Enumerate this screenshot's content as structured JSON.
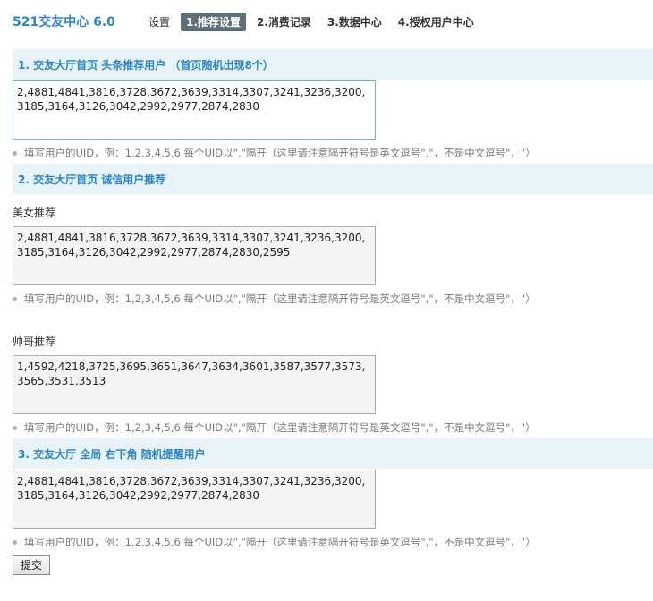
{
  "app": {
    "title": "521交友中心 6.0"
  },
  "nav": {
    "items": [
      {
        "label": "设置"
      },
      {
        "label": "1.推荐设置"
      },
      {
        "label": "2.消费记录"
      },
      {
        "label": "3.数据中心"
      },
      {
        "label": "4.授权用户中心"
      }
    ],
    "active_index": 1
  },
  "hint_text": "填写用户的UID，例：1,2,3,4,5,6 每个UID以\",\"隔开（这里请注意隔开符号是英文逗号\",\"，不是中文逗号\"，\"）",
  "sections": [
    {
      "title": "1. 交友大厅首页 头条推荐用户 （首页随机出现8个）",
      "value": "2,4881,4841,3816,3728,3672,3639,3314,3307,3241,3236,3200,3185,3164,3126,3042,2992,2977,2874,2830"
    },
    {
      "title": "2. 交友大厅首页 诚信用户推荐",
      "groups": [
        {
          "label": "美女推荐",
          "value": "2,4881,4841,3816,3728,3672,3639,3314,3307,3241,3236,3200,3185,3164,3126,3042,2992,2977,2874,2830,2595"
        },
        {
          "label": "帅哥推荐",
          "value": "1,4592,4218,3725,3695,3651,3647,3634,3601,3587,3577,3573,3565,3531,3513"
        }
      ]
    },
    {
      "title": "3. 交友大厅 全局 右下角 随机提醒用户",
      "value": "2,4881,4841,3816,3728,3672,3639,3314,3307,3241,3236,3200,3185,3164,3126,3042,2992,2977,2874,2830"
    }
  ],
  "submit_label": "提交"
}
